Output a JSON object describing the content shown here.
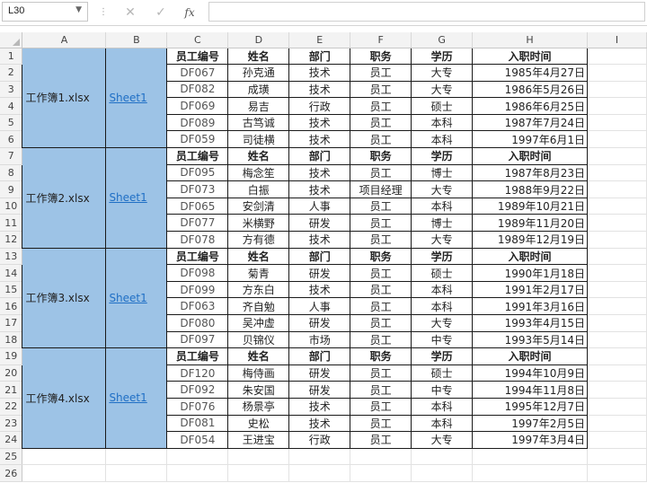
{
  "formula_bar": {
    "name_box": "L30",
    "cancel_icon": "✕",
    "enter_icon": "✓",
    "fx_label": "fx",
    "formula": ""
  },
  "columns": [
    "A",
    "B",
    "C",
    "D",
    "E",
    "F",
    "G",
    "H",
    "I"
  ],
  "rows": [
    "1",
    "2",
    "3",
    "4",
    "5",
    "6",
    "7",
    "8",
    "9",
    "10",
    "11",
    "12",
    "13",
    "14",
    "15",
    "16",
    "17",
    "18",
    "19",
    "20",
    "21",
    "22",
    "23",
    "24",
    "25",
    "26"
  ],
  "header_labels": [
    "员工编号",
    "姓名",
    "部门",
    "职务",
    "学历",
    "入职时间"
  ],
  "groups": [
    {
      "file": "工作簿1.xlsx",
      "sheet": "Sheet1",
      "records": [
        [
          "DF067",
          "孙克通",
          "技术",
          "员工",
          "大专",
          "1985年4月27日"
        ],
        [
          "DF082",
          "成璜",
          "技术",
          "员工",
          "大专",
          "1986年5月26日"
        ],
        [
          "DF069",
          "易吉",
          "行政",
          "员工",
          "硕士",
          "1986年6月25日"
        ],
        [
          "DF089",
          "古笃诚",
          "技术",
          "员工",
          "本科",
          "1987年7月24日"
        ],
        [
          "DF059",
          "司徒横",
          "技术",
          "员工",
          "本科",
          "1997年6月1日"
        ]
      ]
    },
    {
      "file": "工作簿2.xlsx",
      "sheet": "Sheet1",
      "records": [
        [
          "DF095",
          "梅念笙",
          "技术",
          "员工",
          "博士",
          "1987年8月23日"
        ],
        [
          "DF073",
          "白振",
          "技术",
          "项目经理",
          "大专",
          "1988年9月22日"
        ],
        [
          "DF065",
          "安剑清",
          "人事",
          "员工",
          "本科",
          "1989年10月21日"
        ],
        [
          "DF077",
          "米横野",
          "研发",
          "员工",
          "博士",
          "1989年11月20日"
        ],
        [
          "DF078",
          "方有德",
          "技术",
          "员工",
          "大专",
          "1989年12月19日"
        ]
      ]
    },
    {
      "file": "工作簿3.xlsx",
      "sheet": "Sheet1",
      "records": [
        [
          "DF098",
          "菊青",
          "研发",
          "员工",
          "硕士",
          "1990年1月18日"
        ],
        [
          "DF099",
          "方东白",
          "技术",
          "员工",
          "本科",
          "1991年2月17日"
        ],
        [
          "DF063",
          "齐自勉",
          "人事",
          "员工",
          "本科",
          "1991年3月16日"
        ],
        [
          "DF080",
          "吴冲虚",
          "研发",
          "员工",
          "大专",
          "1993年4月15日"
        ],
        [
          "DF097",
          "贝锦仪",
          "市场",
          "员工",
          "中专",
          "1993年5月14日"
        ]
      ]
    },
    {
      "file": "工作簿4.xlsx",
      "sheet": "Sheet1",
      "records": [
        [
          "DF120",
          "梅侍画",
          "研发",
          "员工",
          "硕士",
          "1994年10月9日"
        ],
        [
          "DF092",
          "朱安国",
          "研发",
          "员工",
          "中专",
          "1994年11月8日"
        ],
        [
          "DF076",
          "杨景亭",
          "技术",
          "员工",
          "本科",
          "1995年12月7日"
        ],
        [
          "DF081",
          "史松",
          "技术",
          "员工",
          "本科",
          "1997年2月5日"
        ],
        [
          "DF054",
          "王进宝",
          "行政",
          "员工",
          "大专",
          "1997年3月4日"
        ]
      ]
    }
  ],
  "colors": {
    "file_cell_fill": "#9dc3e6",
    "link": "#1f6fc5",
    "header_bg": "#f3f3f3"
  }
}
